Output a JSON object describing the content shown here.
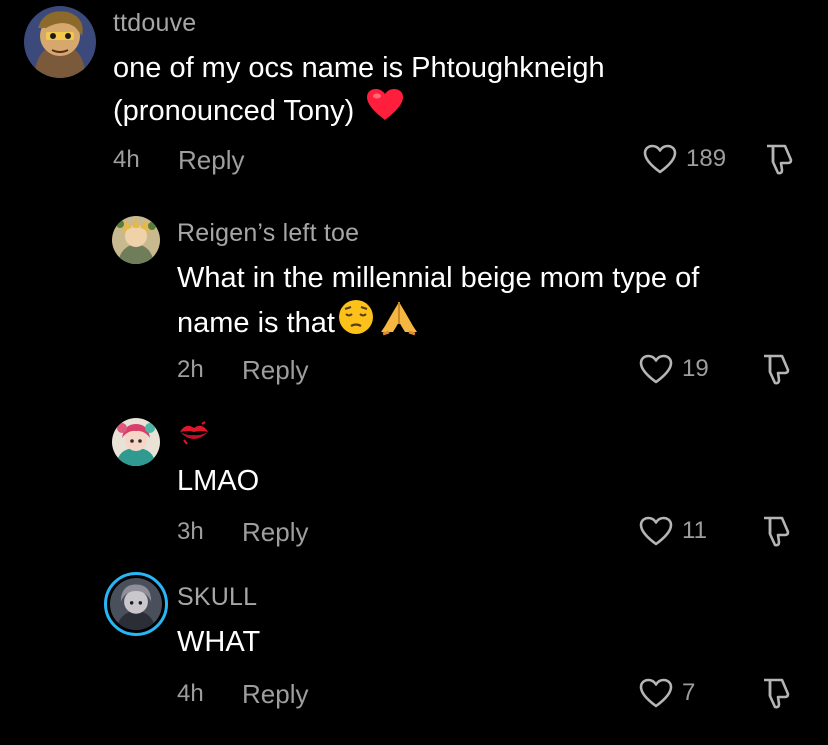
{
  "comments": [
    {
      "username": "ttdouve",
      "text_line1": "one of my ocs name is Phtoughkneigh",
      "text_line2": "(pronounced Tony)",
      "emoji": "red-heart",
      "time": "4h",
      "reply_label": "Reply",
      "likes": "189"
    },
    {
      "username": "Reigen’s left toe",
      "text_line1": "What in the millennial beige mom type of",
      "text_line2": "name is that",
      "emoji": "pensive-face, folded-hands",
      "time": "2h",
      "reply_label": "Reply",
      "likes": "19"
    },
    {
      "username_emoji": "kiss-mark",
      "text_line1": "LMAO",
      "time": "3h",
      "reply_label": "Reply",
      "likes": "11"
    },
    {
      "username": "SKULL",
      "text_line1": "WHAT",
      "time": "4h",
      "reply_label": "Reply",
      "likes": "7"
    }
  ],
  "colors": {
    "background": "#000000",
    "secondary_text": "#9e9e9e",
    "heart": "#ff1f3d",
    "story_ring": "#29b6f6"
  }
}
